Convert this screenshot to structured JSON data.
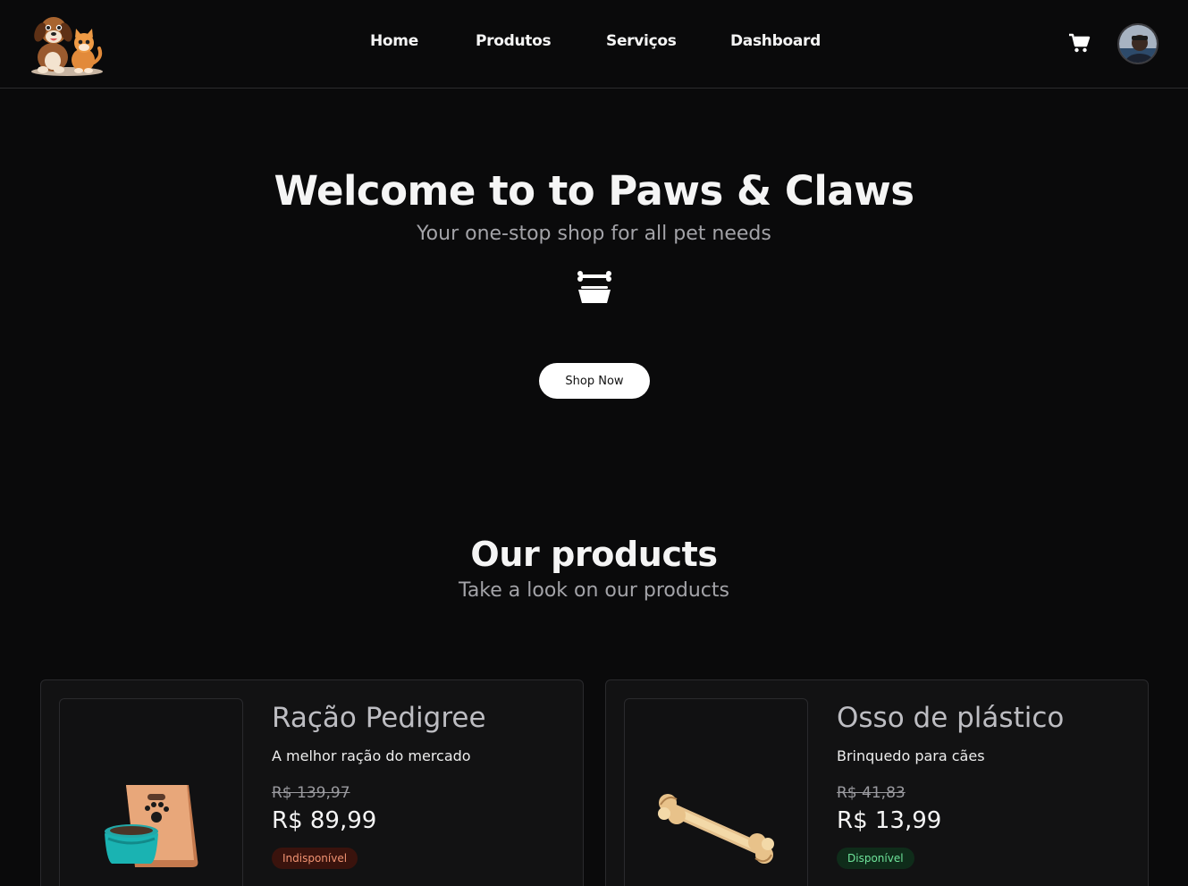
{
  "header": {
    "nav": [
      "Home",
      "Produtos",
      "Serviços",
      "Dashboard"
    ]
  },
  "hero": {
    "title": "Welcome to to Paws & Claws",
    "subtitle": "Your one-stop shop for all pet needs",
    "cta": "Shop Now"
  },
  "products_section": {
    "title": "Our products",
    "subtitle": "Take a look on our products"
  },
  "products": [
    {
      "name": "Ração Pedigree",
      "description": "A melhor ração do mercado",
      "old_price": "R$ 139,97",
      "price": "R$ 89,99",
      "status": "Indisponível",
      "icon": "pet-food-bag-icon"
    },
    {
      "name": "Osso de plástico",
      "description": "Brinquedo para cães",
      "old_price": "R$ 41,83",
      "price": "R$ 13,99",
      "status": "Disponível",
      "icon": "bone-toy-icon"
    }
  ],
  "colors": {
    "background": "#0a0a0b",
    "card": "#121213",
    "unavailable_badge": "#3a130d",
    "available_badge": "#0f2c1a"
  }
}
